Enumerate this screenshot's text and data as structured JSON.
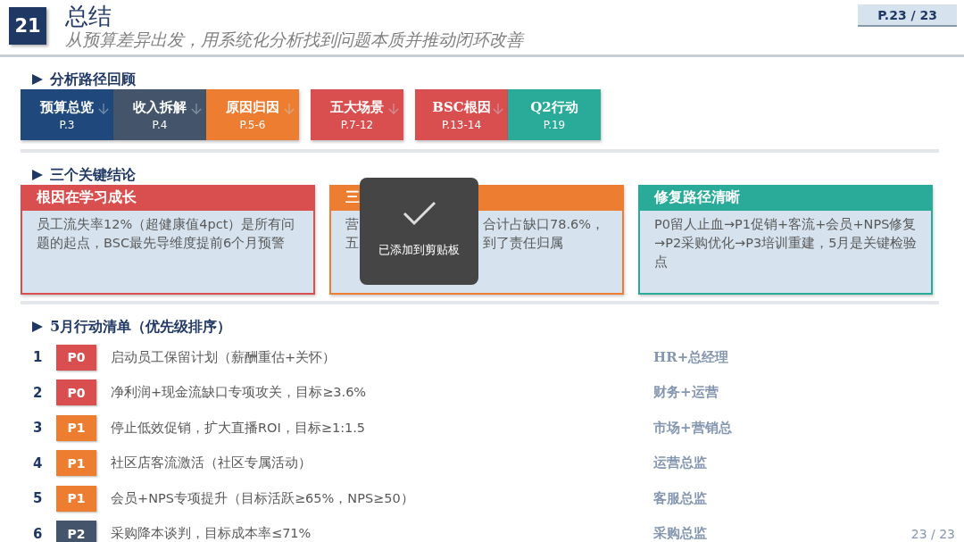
{
  "slide_number": "21",
  "title": "总结",
  "subtitle": "从预算差异出发，用系统化分析找到问题本质并推动闭环改善",
  "page_badge": "P.23 / 23",
  "path_section": {
    "heading": "分析路径回顾",
    "step_groups": [
      [
        {
          "title": "预算总览",
          "pages": "P.3",
          "color": "#1f497d",
          "arrow": true
        },
        {
          "title": "收入拆解",
          "pages": "P.4",
          "color": "#44546a",
          "arrow": true
        },
        {
          "title": "原因归因",
          "pages": "P.5-6",
          "color": "#ed7d31",
          "arrow": true
        }
      ],
      [
        {
          "title": "五大场景",
          "pages": "P.7-12",
          "color": "#d94f4f",
          "arrow": true
        }
      ],
      [
        {
          "title": "BSC根因",
          "pages": "P.13-14",
          "color": "#d94f4f",
          "arrow": true
        },
        {
          "title": "Q2行动",
          "pages": "P.19",
          "color": "#2aab9a",
          "arrow": false
        }
      ]
    ]
  },
  "conclusions_section": {
    "heading": "三个关键结论",
    "cards": [
      {
        "kind": "text",
        "title": "根因在学习成长",
        "color": "#d94f4f",
        "body": "员工流失率12%（超健康值4pct）是所有问题的起点，BSC最先导维度提前6个月预警"
      },
      {
        "kind": "partial",
        "title": "三",
        "color": "#ed7d31",
        "fragments": [
          [
            "营",
            "合计占缺口78.6%，"
          ],
          [
            "五",
            "到了责任归属"
          ]
        ]
      },
      {
        "kind": "text",
        "title": "修复路径清晰",
        "color": "#2aab9a",
        "body": "P0留人止血→P1促销+客流+会员+NPS修复→P2采购优化→P3培训重建，5月是关键检验点"
      }
    ]
  },
  "actions_section": {
    "heading": "5月行动清单（优先级排序）",
    "actions": [
      {
        "number": "1",
        "priority": "P0",
        "color": "#d94f4f",
        "task": "启动员工保留计划（薪酬重估+关怀）",
        "owner": "HR+总经理"
      },
      {
        "number": "2",
        "priority": "P0",
        "color": "#d94f4f",
        "task": "净利润+现金流缺口专项攻关，目标≥3.6%",
        "owner": "财务+运营"
      },
      {
        "number": "3",
        "priority": "P1",
        "color": "#ed7d31",
        "task": "停止低效促销，扩大直播ROI，目标≥1:1.5",
        "owner": "市场+营销总"
      },
      {
        "number": "4",
        "priority": "P1",
        "color": "#ed7d31",
        "task": "社区店客流激活（社区专属活动）",
        "owner": "运营总监"
      },
      {
        "number": "5",
        "priority": "P1",
        "color": "#ed7d31",
        "task": "会员+NPS专项提升（目标活跃≥65%，NPS≥50）",
        "owner": "客服总监"
      },
      {
        "number": "6",
        "priority": "P2",
        "color": "#44546a",
        "task": "采购降本谈判，目标成本率≤71%",
        "owner": "采购总监"
      }
    ]
  },
  "toast": {
    "text": "已添加到剪贴板"
  },
  "footer": "23 / 23"
}
